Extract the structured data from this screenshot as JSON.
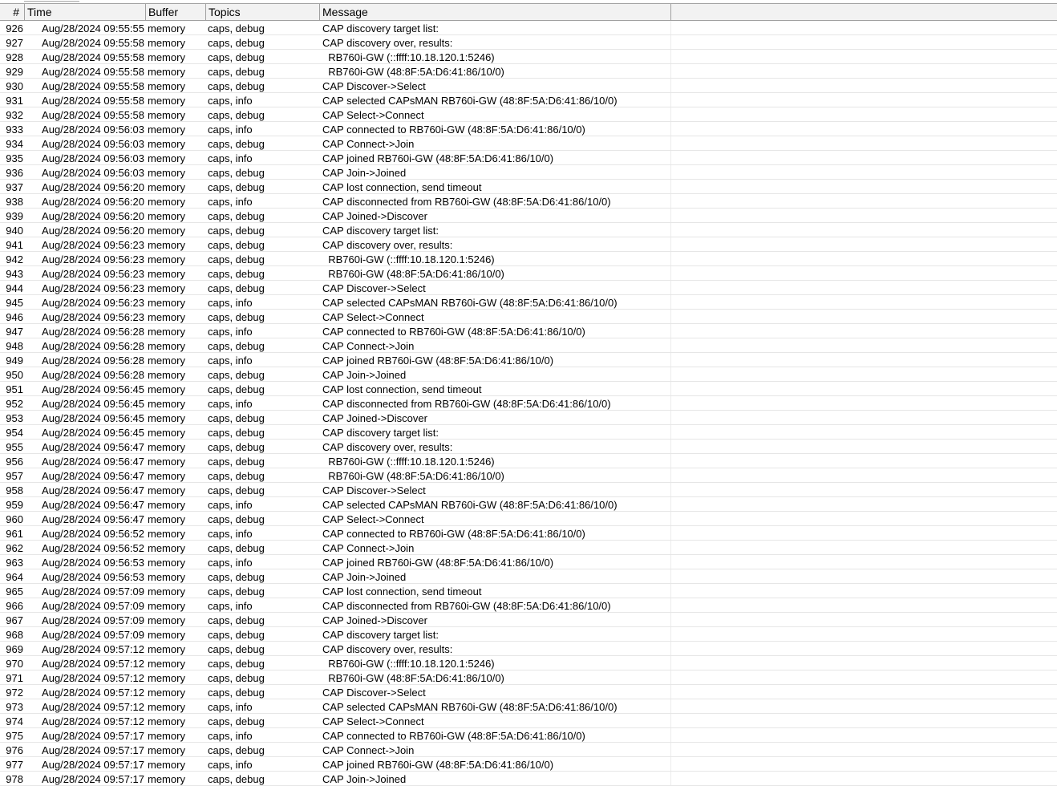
{
  "columns": {
    "num": "#",
    "time": "Time",
    "buffer": "Buffer",
    "topics": "Topics",
    "message": "Message"
  },
  "rows": [
    {
      "num": "926",
      "time": "Aug/28/2024 09:55:55",
      "buffer": "memory",
      "topics": "caps, debug",
      "message": "CAP discovery target list:"
    },
    {
      "num": "927",
      "time": "Aug/28/2024 09:55:58",
      "buffer": "memory",
      "topics": "caps, debug",
      "message": "CAP discovery over, results:"
    },
    {
      "num": "928",
      "time": "Aug/28/2024 09:55:58",
      "buffer": "memory",
      "topics": "caps, debug",
      "message": "  RB760i-GW (::ffff:10.18.120.1:5246)"
    },
    {
      "num": "929",
      "time": "Aug/28/2024 09:55:58",
      "buffer": "memory",
      "topics": "caps, debug",
      "message": "  RB760i-GW (48:8F:5A:D6:41:86/10/0)"
    },
    {
      "num": "930",
      "time": "Aug/28/2024 09:55:58",
      "buffer": "memory",
      "topics": "caps, debug",
      "message": "CAP Discover->Select"
    },
    {
      "num": "931",
      "time": "Aug/28/2024 09:55:58",
      "buffer": "memory",
      "topics": "caps, info",
      "message": "CAP selected CAPsMAN RB760i-GW (48:8F:5A:D6:41:86/10/0)"
    },
    {
      "num": "932",
      "time": "Aug/28/2024 09:55:58",
      "buffer": "memory",
      "topics": "caps, debug",
      "message": "CAP Select->Connect"
    },
    {
      "num": "933",
      "time": "Aug/28/2024 09:56:03",
      "buffer": "memory",
      "topics": "caps, info",
      "message": "CAP connected to RB760i-GW (48:8F:5A:D6:41:86/10/0)"
    },
    {
      "num": "934",
      "time": "Aug/28/2024 09:56:03",
      "buffer": "memory",
      "topics": "caps, debug",
      "message": "CAP Connect->Join"
    },
    {
      "num": "935",
      "time": "Aug/28/2024 09:56:03",
      "buffer": "memory",
      "topics": "caps, info",
      "message": "CAP joined RB760i-GW (48:8F:5A:D6:41:86/10/0)"
    },
    {
      "num": "936",
      "time": "Aug/28/2024 09:56:03",
      "buffer": "memory",
      "topics": "caps, debug",
      "message": "CAP Join->Joined"
    },
    {
      "num": "937",
      "time": "Aug/28/2024 09:56:20",
      "buffer": "memory",
      "topics": "caps, debug",
      "message": "CAP lost connection, send timeout"
    },
    {
      "num": "938",
      "time": "Aug/28/2024 09:56:20",
      "buffer": "memory",
      "topics": "caps, info",
      "message": "CAP disconnected from RB760i-GW (48:8F:5A:D6:41:86/10/0)"
    },
    {
      "num": "939",
      "time": "Aug/28/2024 09:56:20",
      "buffer": "memory",
      "topics": "caps, debug",
      "message": "CAP Joined->Discover"
    },
    {
      "num": "940",
      "time": "Aug/28/2024 09:56:20",
      "buffer": "memory",
      "topics": "caps, debug",
      "message": "CAP discovery target list:"
    },
    {
      "num": "941",
      "time": "Aug/28/2024 09:56:23",
      "buffer": "memory",
      "topics": "caps, debug",
      "message": "CAP discovery over, results:"
    },
    {
      "num": "942",
      "time": "Aug/28/2024 09:56:23",
      "buffer": "memory",
      "topics": "caps, debug",
      "message": "  RB760i-GW (::ffff:10.18.120.1:5246)"
    },
    {
      "num": "943",
      "time": "Aug/28/2024 09:56:23",
      "buffer": "memory",
      "topics": "caps, debug",
      "message": "  RB760i-GW (48:8F:5A:D6:41:86/10/0)"
    },
    {
      "num": "944",
      "time": "Aug/28/2024 09:56:23",
      "buffer": "memory",
      "topics": "caps, debug",
      "message": "CAP Discover->Select"
    },
    {
      "num": "945",
      "time": "Aug/28/2024 09:56:23",
      "buffer": "memory",
      "topics": "caps, info",
      "message": "CAP selected CAPsMAN RB760i-GW (48:8F:5A:D6:41:86/10/0)"
    },
    {
      "num": "946",
      "time": "Aug/28/2024 09:56:23",
      "buffer": "memory",
      "topics": "caps, debug",
      "message": "CAP Select->Connect"
    },
    {
      "num": "947",
      "time": "Aug/28/2024 09:56:28",
      "buffer": "memory",
      "topics": "caps, info",
      "message": "CAP connected to RB760i-GW (48:8F:5A:D6:41:86/10/0)"
    },
    {
      "num": "948",
      "time": "Aug/28/2024 09:56:28",
      "buffer": "memory",
      "topics": "caps, debug",
      "message": "CAP Connect->Join"
    },
    {
      "num": "949",
      "time": "Aug/28/2024 09:56:28",
      "buffer": "memory",
      "topics": "caps, info",
      "message": "CAP joined RB760i-GW (48:8F:5A:D6:41:86/10/0)"
    },
    {
      "num": "950",
      "time": "Aug/28/2024 09:56:28",
      "buffer": "memory",
      "topics": "caps, debug",
      "message": "CAP Join->Joined"
    },
    {
      "num": "951",
      "time": "Aug/28/2024 09:56:45",
      "buffer": "memory",
      "topics": "caps, debug",
      "message": "CAP lost connection, send timeout"
    },
    {
      "num": "952",
      "time": "Aug/28/2024 09:56:45",
      "buffer": "memory",
      "topics": "caps, info",
      "message": "CAP disconnected from RB760i-GW (48:8F:5A:D6:41:86/10/0)"
    },
    {
      "num": "953",
      "time": "Aug/28/2024 09:56:45",
      "buffer": "memory",
      "topics": "caps, debug",
      "message": "CAP Joined->Discover"
    },
    {
      "num": "954",
      "time": "Aug/28/2024 09:56:45",
      "buffer": "memory",
      "topics": "caps, debug",
      "message": "CAP discovery target list:"
    },
    {
      "num": "955",
      "time": "Aug/28/2024 09:56:47",
      "buffer": "memory",
      "topics": "caps, debug",
      "message": "CAP discovery over, results:"
    },
    {
      "num": "956",
      "time": "Aug/28/2024 09:56:47",
      "buffer": "memory",
      "topics": "caps, debug",
      "message": "  RB760i-GW (::ffff:10.18.120.1:5246)"
    },
    {
      "num": "957",
      "time": "Aug/28/2024 09:56:47",
      "buffer": "memory",
      "topics": "caps, debug",
      "message": "  RB760i-GW (48:8F:5A:D6:41:86/10/0)"
    },
    {
      "num": "958",
      "time": "Aug/28/2024 09:56:47",
      "buffer": "memory",
      "topics": "caps, debug",
      "message": "CAP Discover->Select"
    },
    {
      "num": "959",
      "time": "Aug/28/2024 09:56:47",
      "buffer": "memory",
      "topics": "caps, info",
      "message": "CAP selected CAPsMAN RB760i-GW (48:8F:5A:D6:41:86/10/0)"
    },
    {
      "num": "960",
      "time": "Aug/28/2024 09:56:47",
      "buffer": "memory",
      "topics": "caps, debug",
      "message": "CAP Select->Connect"
    },
    {
      "num": "961",
      "time": "Aug/28/2024 09:56:52",
      "buffer": "memory",
      "topics": "caps, info",
      "message": "CAP connected to RB760i-GW (48:8F:5A:D6:41:86/10/0)"
    },
    {
      "num": "962",
      "time": "Aug/28/2024 09:56:52",
      "buffer": "memory",
      "topics": "caps, debug",
      "message": "CAP Connect->Join"
    },
    {
      "num": "963",
      "time": "Aug/28/2024 09:56:53",
      "buffer": "memory",
      "topics": "caps, info",
      "message": "CAP joined RB760i-GW (48:8F:5A:D6:41:86/10/0)"
    },
    {
      "num": "964",
      "time": "Aug/28/2024 09:56:53",
      "buffer": "memory",
      "topics": "caps, debug",
      "message": "CAP Join->Joined"
    },
    {
      "num": "965",
      "time": "Aug/28/2024 09:57:09",
      "buffer": "memory",
      "topics": "caps, debug",
      "message": "CAP lost connection, send timeout"
    },
    {
      "num": "966",
      "time": "Aug/28/2024 09:57:09",
      "buffer": "memory",
      "topics": "caps, info",
      "message": "CAP disconnected from RB760i-GW (48:8F:5A:D6:41:86/10/0)"
    },
    {
      "num": "967",
      "time": "Aug/28/2024 09:57:09",
      "buffer": "memory",
      "topics": "caps, debug",
      "message": "CAP Joined->Discover"
    },
    {
      "num": "968",
      "time": "Aug/28/2024 09:57:09",
      "buffer": "memory",
      "topics": "caps, debug",
      "message": "CAP discovery target list:"
    },
    {
      "num": "969",
      "time": "Aug/28/2024 09:57:12",
      "buffer": "memory",
      "topics": "caps, debug",
      "message": "CAP discovery over, results:"
    },
    {
      "num": "970",
      "time": "Aug/28/2024 09:57:12",
      "buffer": "memory",
      "topics": "caps, debug",
      "message": "  RB760i-GW (::ffff:10.18.120.1:5246)"
    },
    {
      "num": "971",
      "time": "Aug/28/2024 09:57:12",
      "buffer": "memory",
      "topics": "caps, debug",
      "message": "  RB760i-GW (48:8F:5A:D6:41:86/10/0)"
    },
    {
      "num": "972",
      "time": "Aug/28/2024 09:57:12",
      "buffer": "memory",
      "topics": "caps, debug",
      "message": "CAP Discover->Select"
    },
    {
      "num": "973",
      "time": "Aug/28/2024 09:57:12",
      "buffer": "memory",
      "topics": "caps, info",
      "message": "CAP selected CAPsMAN RB760i-GW (48:8F:5A:D6:41:86/10/0)"
    },
    {
      "num": "974",
      "time": "Aug/28/2024 09:57:12",
      "buffer": "memory",
      "topics": "caps, debug",
      "message": "CAP Select->Connect"
    },
    {
      "num": "975",
      "time": "Aug/28/2024 09:57:17",
      "buffer": "memory",
      "topics": "caps, info",
      "message": "CAP connected to RB760i-GW (48:8F:5A:D6:41:86/10/0)"
    },
    {
      "num": "976",
      "time": "Aug/28/2024 09:57:17",
      "buffer": "memory",
      "topics": "caps, debug",
      "message": "CAP Connect->Join"
    },
    {
      "num": "977",
      "time": "Aug/28/2024 09:57:17",
      "buffer": "memory",
      "topics": "caps, info",
      "message": "CAP joined RB760i-GW (48:8F:5A:D6:41:86/10/0)"
    },
    {
      "num": "978",
      "time": "Aug/28/2024 09:57:17",
      "buffer": "memory",
      "topics": "caps, debug",
      "message": "CAP Join->Joined"
    }
  ]
}
